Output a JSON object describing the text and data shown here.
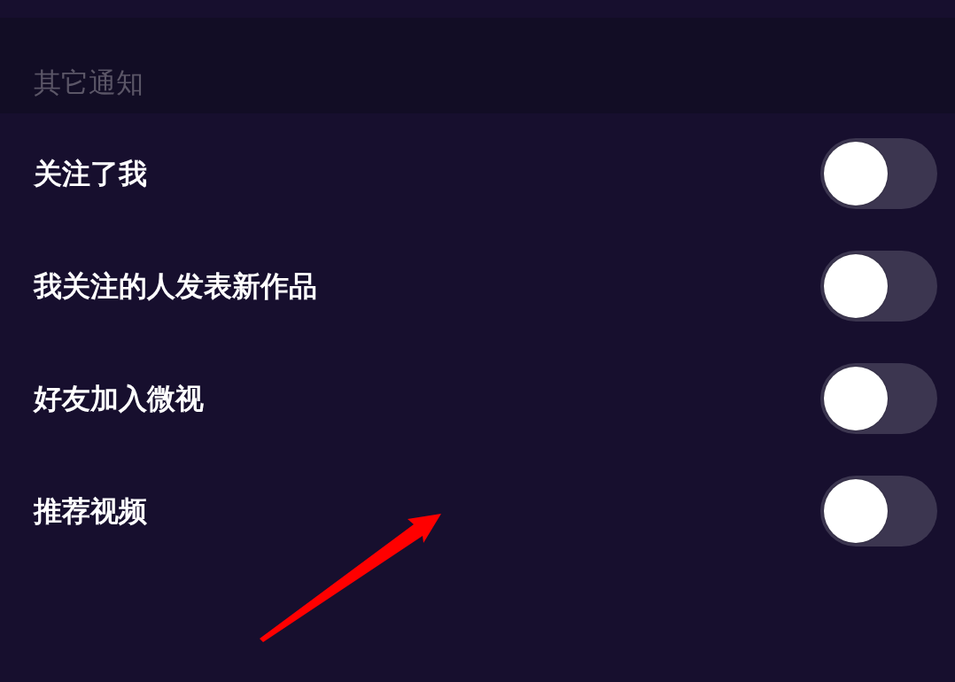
{
  "section": {
    "title": "其它通知"
  },
  "settings": [
    {
      "label": "关注了我",
      "on": false
    },
    {
      "label": "我关注的人发表新作品",
      "on": false
    },
    {
      "label": "好友加入微视",
      "on": false
    },
    {
      "label": "推荐视频",
      "on": false
    }
  ]
}
